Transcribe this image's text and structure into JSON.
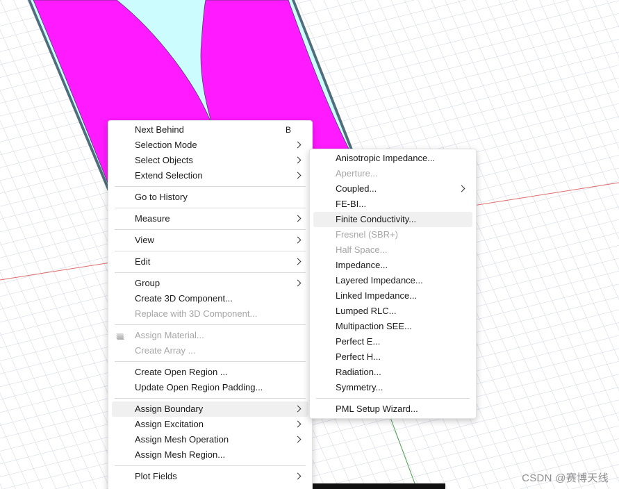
{
  "context_menu": {
    "groups": [
      [
        {
          "label": "Next Behind",
          "shortcut": "B",
          "submenu": false,
          "disabled": false
        },
        {
          "label": "Selection Mode",
          "submenu": true,
          "disabled": false
        },
        {
          "label": "Select Objects",
          "submenu": true,
          "disabled": false
        },
        {
          "label": "Extend Selection",
          "submenu": true,
          "disabled": false
        }
      ],
      [
        {
          "label": "Go to History",
          "submenu": false,
          "disabled": false
        }
      ],
      [
        {
          "label": "Measure",
          "submenu": true,
          "disabled": false
        }
      ],
      [
        {
          "label": "View",
          "submenu": true,
          "disabled": false
        }
      ],
      [
        {
          "label": "Edit",
          "submenu": true,
          "disabled": false
        }
      ],
      [
        {
          "label": "Group",
          "submenu": true,
          "disabled": false
        },
        {
          "label": "Create 3D Component...",
          "submenu": false,
          "disabled": false
        },
        {
          "label": "Replace with 3D Component...",
          "submenu": false,
          "disabled": true
        }
      ],
      [
        {
          "label": "Assign Material...",
          "submenu": false,
          "disabled": true,
          "icon": "material-stack-icon"
        },
        {
          "label": "Create Array ...",
          "submenu": false,
          "disabled": true
        }
      ],
      [
        {
          "label": "Create Open Region ...",
          "submenu": false,
          "disabled": false
        },
        {
          "label": "Update Open Region Padding...",
          "submenu": false,
          "disabled": false
        }
      ],
      [
        {
          "label": "Assign Boundary",
          "submenu": true,
          "disabled": false,
          "highlighted": true
        },
        {
          "label": "Assign Excitation",
          "submenu": true,
          "disabled": false
        },
        {
          "label": "Assign Mesh Operation",
          "submenu": true,
          "disabled": false
        },
        {
          "label": "Assign Mesh Region...",
          "submenu": false,
          "disabled": false
        }
      ],
      [
        {
          "label": "Plot Fields",
          "submenu": true,
          "disabled": false
        }
      ]
    ]
  },
  "boundary_submenu": {
    "groups": [
      [
        {
          "label": "Anisotropic Impedance...",
          "submenu": false,
          "disabled": false
        },
        {
          "label": "Aperture...",
          "submenu": false,
          "disabled": true
        },
        {
          "label": "Coupled...",
          "submenu": true,
          "disabled": false
        },
        {
          "label": "FE-BI...",
          "submenu": false,
          "disabled": false
        },
        {
          "label": "Finite Conductivity...",
          "submenu": false,
          "disabled": false,
          "highlighted": true
        },
        {
          "label": "Fresnel (SBR+)",
          "submenu": false,
          "disabled": true
        },
        {
          "label": "Half Space...",
          "submenu": false,
          "disabled": true
        },
        {
          "label": "Impedance...",
          "submenu": false,
          "disabled": false
        },
        {
          "label": "Layered Impedance...",
          "submenu": false,
          "disabled": false
        },
        {
          "label": "Linked Impedance...",
          "submenu": false,
          "disabled": false
        },
        {
          "label": "Lumped RLC...",
          "submenu": false,
          "disabled": false
        },
        {
          "label": "Multipaction SEE...",
          "submenu": false,
          "disabled": false
        },
        {
          "label": "Perfect E...",
          "submenu": false,
          "disabled": false
        },
        {
          "label": "Perfect H...",
          "submenu": false,
          "disabled": false
        },
        {
          "label": "Radiation...",
          "submenu": false,
          "disabled": false
        },
        {
          "label": "Symmetry...",
          "submenu": false,
          "disabled": false
        }
      ],
      [
        {
          "label": "PML Setup Wizard...",
          "submenu": false,
          "disabled": false
        }
      ]
    ]
  },
  "scene": {
    "grid_color": "#cfd3e4",
    "axis_red_color": "#e06a6a",
    "axis_green_color": "#4aa04a",
    "patch_magenta_color": "#ff1aff",
    "patch_cyan_color": "#cdfcff",
    "substrate_edge_color": "#4f6d7a"
  },
  "watermark": {
    "text": "CSDN @赛博天线"
  }
}
